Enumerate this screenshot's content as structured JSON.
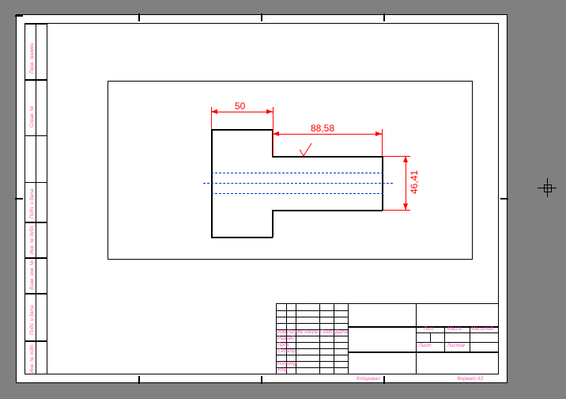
{
  "dimensions": {
    "d1": "50",
    "d2": "88,58",
    "d3": "46,41"
  },
  "binding_labels": {
    "l1": "Подп. и дата",
    "l2": "Инв. № дубл.",
    "l3": "Взам. инв. №",
    "l4": "Подп. и дата",
    "l5": "Инв. № подл.",
    "l6": "Справ. №",
    "l7": "Перв. примен."
  },
  "titleblock": {
    "c1": "Изм.",
    "c2": "Лист",
    "c3": "№ докум.",
    "c4": "Подп.",
    "c5": "Дата",
    "r1": "Разраб.",
    "r2": "Пров.",
    "r3": "Т.контр.",
    "r4": "",
    "r5": "Н.контр.",
    "r6": "Утв.",
    "lit": "Лит.",
    "massa": "Масса",
    "mashtab": "Масштаб",
    "list": "Лист",
    "listov": "Листов",
    "kopirovka": "Копировал",
    "format": "Формат A3"
  },
  "chart_data": {
    "type": "diagram",
    "description": "Mechanical engineering drawing of a stepped cylindrical shaft shown in side view with centerline and hidden lines, inside a viewport on an A3 GOST title-block sheet.",
    "part": {
      "segment1": {
        "length": 50,
        "shape": "larger rectangular section (flange)"
      },
      "segment2": {
        "length": 88.58,
        "diameter": 46.41,
        "shape": "cylindrical shaft"
      }
    },
    "dimensions_shown": [
      {
        "label": "50",
        "type": "horizontal-linear"
      },
      {
        "label": "88,58",
        "type": "horizontal-linear"
      },
      {
        "label": "46,41",
        "type": "vertical-linear"
      }
    ],
    "annotations": [
      "surface-finish checkmark on shaft top edge"
    ],
    "sheet_format": "A3",
    "standard": "GOST / ЕСКД"
  }
}
